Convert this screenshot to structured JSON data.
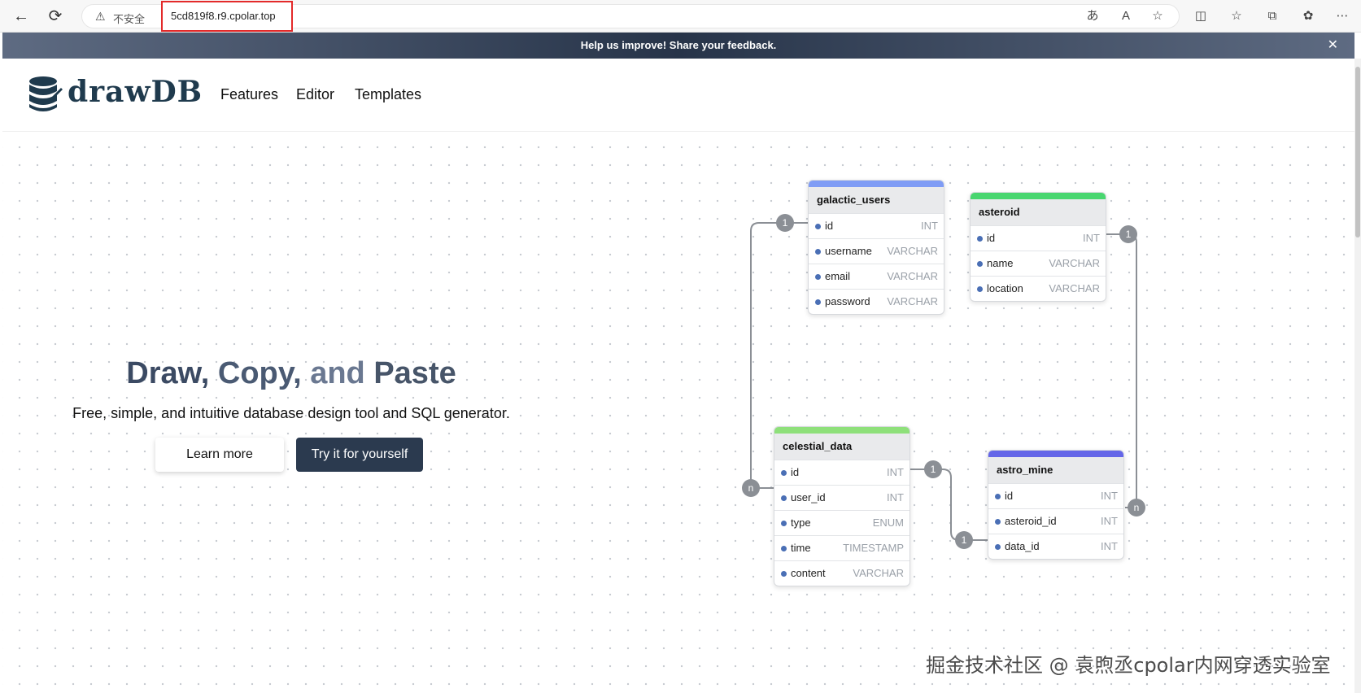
{
  "browser": {
    "security_label": "不安全",
    "url": "5cd819f8.r9.cpolar.top"
  },
  "feedback": {
    "text": "Help us improve! Share your feedback.",
    "close_label": "✕"
  },
  "header": {
    "logo_text": "drawDB",
    "nav": [
      "Features",
      "Editor",
      "Templates"
    ]
  },
  "hero": {
    "title_part1": "Draw, ",
    "title_part2": "Copy, ",
    "title_part3": "and ",
    "title_part4": "Paste",
    "subtitle": "Free, simple, and intuitive database design tool and SQL generator.",
    "learn_more": "Learn more",
    "try_it": "Try it for yourself"
  },
  "tables": [
    {
      "name": "galactic_users",
      "color": "#7f9cf5",
      "fields": [
        {
          "name": "id",
          "type": "INT"
        },
        {
          "name": "username",
          "type": "VARCHAR"
        },
        {
          "name": "email",
          "type": "VARCHAR"
        },
        {
          "name": "password",
          "type": "VARCHAR"
        }
      ]
    },
    {
      "name": "asteroid",
      "color": "#48d66f",
      "fields": [
        {
          "name": "id",
          "type": "INT"
        },
        {
          "name": "name",
          "type": "VARCHAR"
        },
        {
          "name": "location",
          "type": "VARCHAR"
        }
      ]
    },
    {
      "name": "celestial_data",
      "color": "#8ee07a",
      "fields": [
        {
          "name": "id",
          "type": "INT"
        },
        {
          "name": "user_id",
          "type": "INT"
        },
        {
          "name": "type",
          "type": "ENUM"
        },
        {
          "name": "time",
          "type": "TIMESTAMP"
        },
        {
          "name": "content",
          "type": "VARCHAR"
        }
      ]
    },
    {
      "name": "astro_mine",
      "color": "#6466e8",
      "fields": [
        {
          "name": "id",
          "type": "INT"
        },
        {
          "name": "asteroid_id",
          "type": "INT"
        },
        {
          "name": "data_id",
          "type": "INT"
        }
      ]
    }
  ],
  "relations": {
    "one": "1",
    "many": "n"
  },
  "watermark": "掘金技术社区 @ 袁煦丞cpolar内网穿透实验室"
}
